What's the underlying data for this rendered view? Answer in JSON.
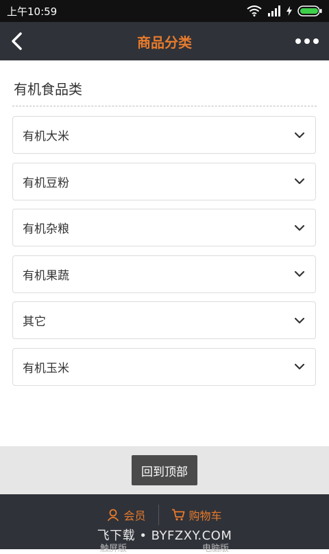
{
  "status_bar": {
    "time": "上午10:59"
  },
  "header": {
    "title": "商品分类"
  },
  "section": {
    "title": "有机食品类"
  },
  "categories": [
    {
      "label": "有机大米"
    },
    {
      "label": "有机豆粉"
    },
    {
      "label": "有机杂粮"
    },
    {
      "label": "有机果蔬"
    },
    {
      "label": "其它"
    },
    {
      "label": "有机玉米"
    }
  ],
  "back_to_top": {
    "label": "回到顶部"
  },
  "footer": {
    "member_label": "会员",
    "cart_label": "购物车",
    "touch_version": "触屏版",
    "pc_version": "电脑版",
    "watermark": "飞下载 • BYFZXY.COM"
  },
  "colors": {
    "accent": "#e87b2c",
    "appbar": "#2f3239"
  }
}
